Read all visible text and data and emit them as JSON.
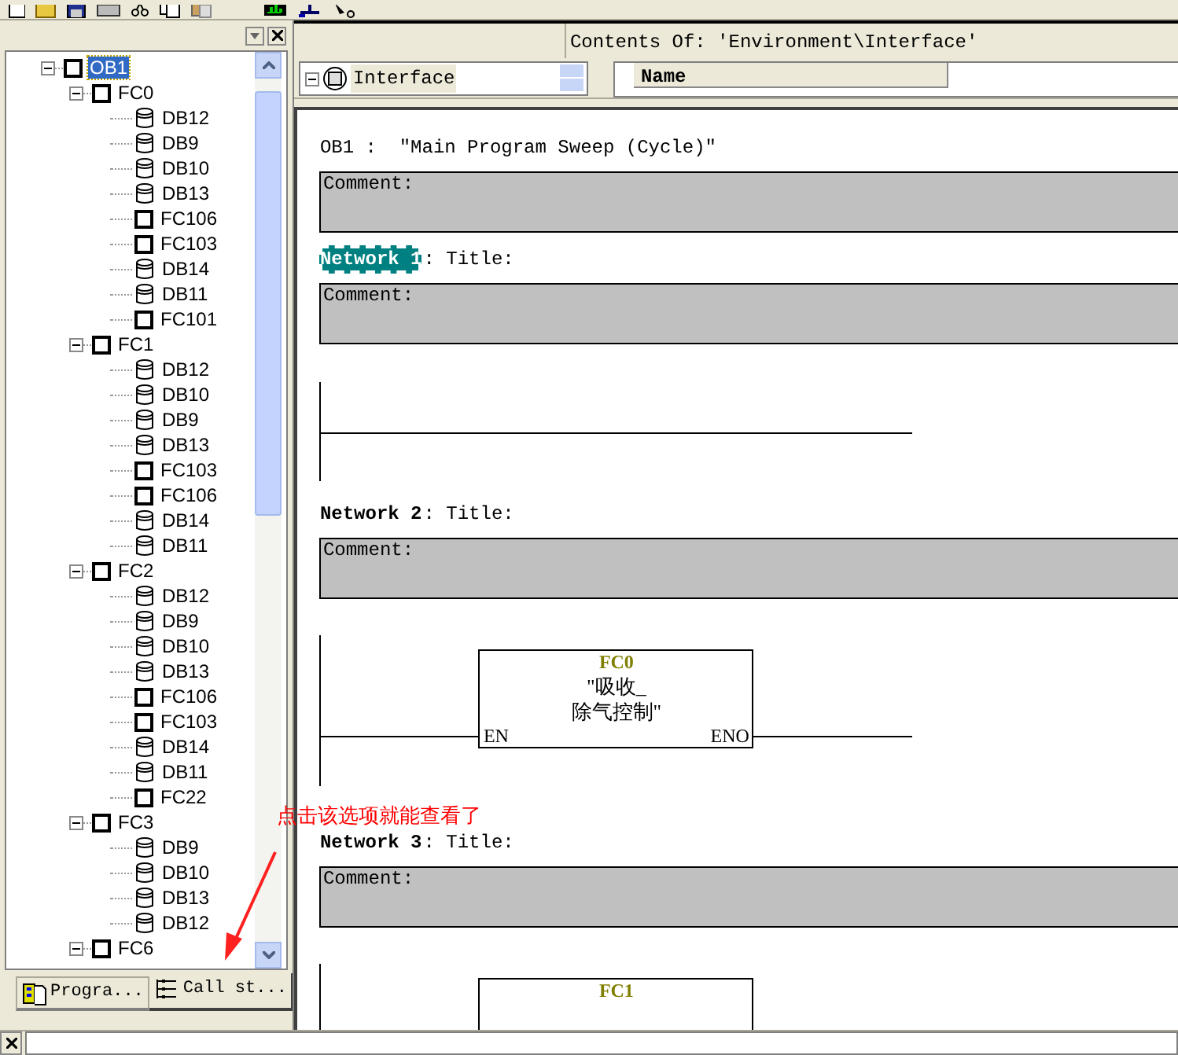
{
  "left_panel": {
    "tree": [
      {
        "label": "OB1",
        "kind": "block",
        "selected": true,
        "expanded": true,
        "children": [
          {
            "label": "FC0",
            "kind": "block",
            "selected": false,
            "expanded": true,
            "children": [
              {
                "label": "DB12",
                "kind": "db",
                "selected": false
              },
              {
                "label": "DB9",
                "kind": "db",
                "selected": false
              },
              {
                "label": "DB10",
                "kind": "db",
                "selected": false
              },
              {
                "label": "DB13",
                "kind": "db",
                "selected": false
              },
              {
                "label": "FC106",
                "kind": "block",
                "selected": false
              },
              {
                "label": "FC103",
                "kind": "block",
                "selected": false
              },
              {
                "label": "DB14",
                "kind": "db",
                "selected": false
              },
              {
                "label": "DB11",
                "kind": "db",
                "selected": false
              },
              {
                "label": "FC101",
                "kind": "block",
                "selected": false
              }
            ]
          },
          {
            "label": "FC1",
            "kind": "block",
            "selected": false,
            "expanded": true,
            "children": [
              {
                "label": "DB12",
                "kind": "db",
                "selected": false
              },
              {
                "label": "DB10",
                "kind": "db",
                "selected": false
              },
              {
                "label": "DB9",
                "kind": "db",
                "selected": false
              },
              {
                "label": "DB13",
                "kind": "db",
                "selected": false
              },
              {
                "label": "FC103",
                "kind": "block",
                "selected": false
              },
              {
                "label": "FC106",
                "kind": "block",
                "selected": false
              },
              {
                "label": "DB14",
                "kind": "db",
                "selected": false
              },
              {
                "label": "DB11",
                "kind": "db",
                "selected": false
              }
            ]
          },
          {
            "label": "FC2",
            "kind": "block",
            "selected": false,
            "expanded": true,
            "children": [
              {
                "label": "DB12",
                "kind": "db",
                "selected": false
              },
              {
                "label": "DB9",
                "kind": "db",
                "selected": false
              },
              {
                "label": "DB10",
                "kind": "db",
                "selected": false
              },
              {
                "label": "DB13",
                "kind": "db",
                "selected": false
              },
              {
                "label": "FC106",
                "kind": "block",
                "selected": false
              },
              {
                "label": "FC103",
                "kind": "block",
                "selected": false
              },
              {
                "label": "DB14",
                "kind": "db",
                "selected": false
              },
              {
                "label": "DB11",
                "kind": "db",
                "selected": false
              },
              {
                "label": "FC22",
                "kind": "block",
                "selected": false
              }
            ]
          },
          {
            "label": "FC3",
            "kind": "block",
            "selected": false,
            "expanded": true,
            "children": [
              {
                "label": "DB9",
                "kind": "db",
                "selected": false
              },
              {
                "label": "DB10",
                "kind": "db",
                "selected": false
              },
              {
                "label": "DB13",
                "kind": "db",
                "selected": false
              },
              {
                "label": "DB12",
                "kind": "db",
                "selected": false
              }
            ]
          },
          {
            "label": "FC6",
            "kind": "block",
            "selected": false,
            "expanded": true
          }
        ]
      }
    ],
    "tabs": [
      {
        "label": "Progra...",
        "selected": false
      },
      {
        "label": "Call st...",
        "selected": true
      }
    ]
  },
  "details": {
    "header": "Contents Of: 'Environment\\Interface'",
    "tree_item": {
      "label": "Interface",
      "expanded": true
    },
    "columns": [
      "Name"
    ]
  },
  "editor": {
    "block_title": "OB1 :  \"Main Program Sweep (Cycle)\"",
    "comment_label": "Comment:",
    "networks": [
      {
        "label": "Network 1",
        "selected": true,
        "title": ": Title:",
        "comment_label": "Comment:",
        "kind": "wire"
      },
      {
        "label": "Network 2",
        "selected": false,
        "title": ": Title:",
        "comment_label": "Comment:",
        "kind": "block",
        "block": {
          "number": "FC0",
          "name": [
            "\"吸收_",
            "除气控制\""
          ],
          "pin_in": "EN",
          "pin_out": "ENO"
        }
      },
      {
        "label": "Network 3",
        "selected": false,
        "title": ": Title:",
        "comment_label": "Comment:",
        "kind": "block",
        "block": {
          "number": "FC1"
        }
      }
    ]
  },
  "annotation": {
    "text": "点击该选项就能查看了"
  }
}
